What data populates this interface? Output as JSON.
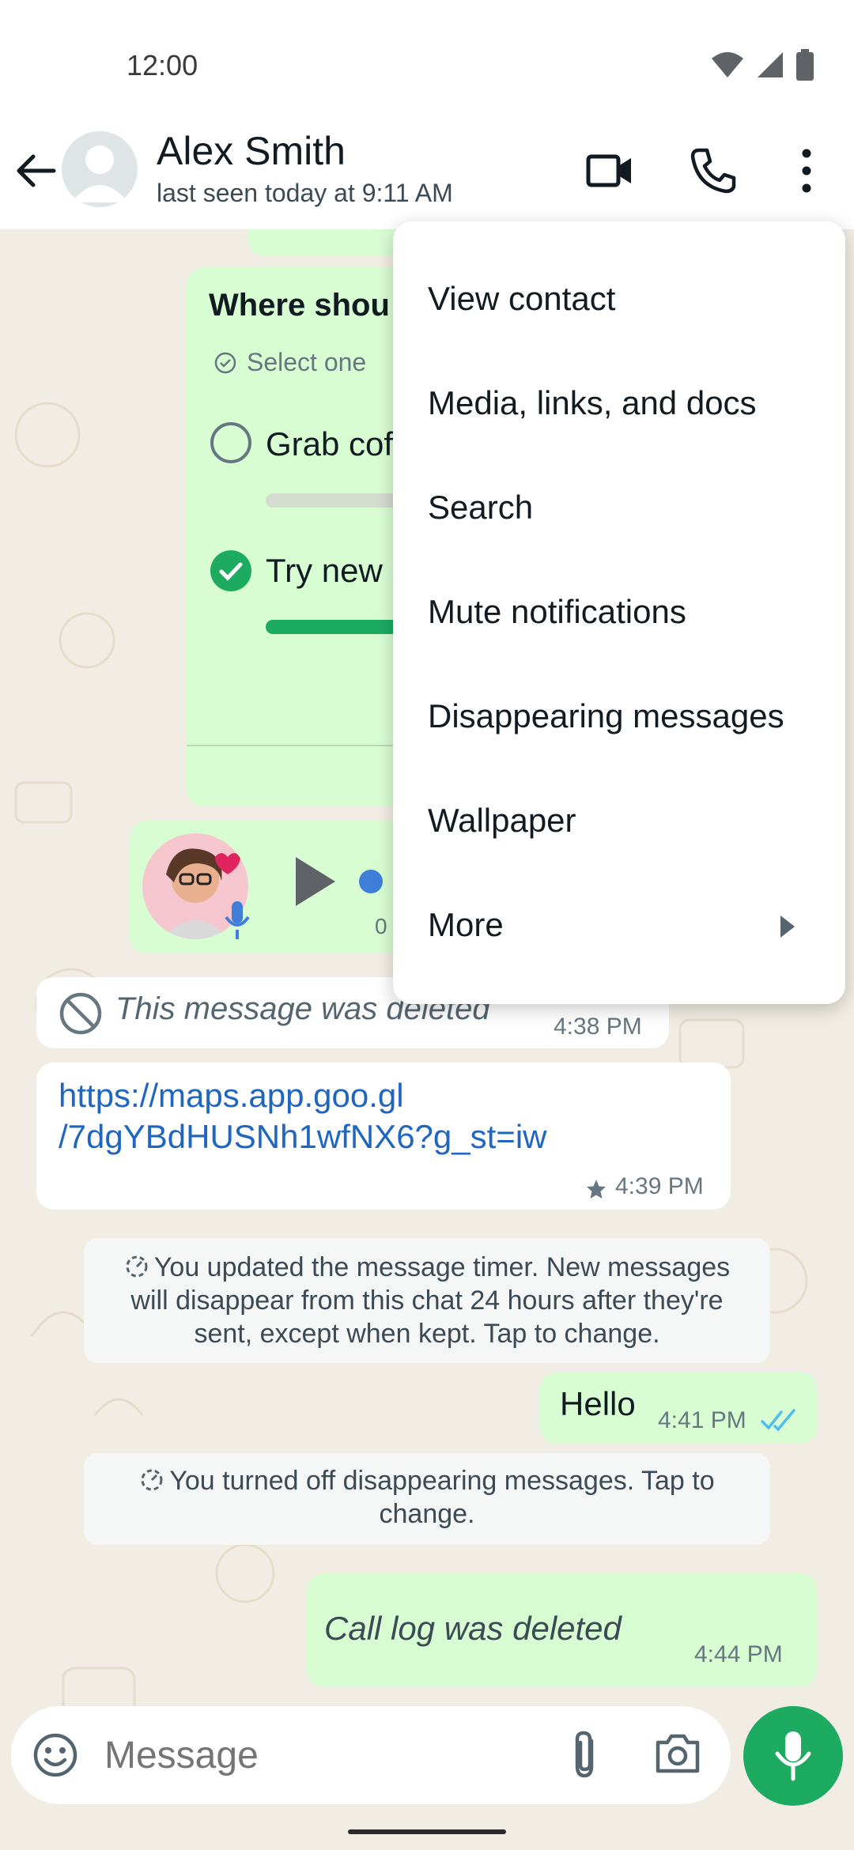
{
  "status": {
    "time": "12:00"
  },
  "header": {
    "name": "Alex Smith",
    "last_seen": "last seen today at 9:11 AM"
  },
  "poll": {
    "question": "Where shou",
    "hint": "Select one",
    "option1": "Grab cof",
    "option2": "Try new"
  },
  "voice": {
    "duration": "0"
  },
  "messages": {
    "deleted_text": "This message was deleted",
    "deleted_time": "4:38 PM",
    "link_line1": "https://maps.app.goo.gl",
    "link_line2": "/7dgYBdHUSNh1wfNX6?g_st=iw",
    "link_time": "4:39 PM",
    "timer_notice": "You updated the message timer. New messages will disappear from this chat 24 hours after they're sent, except when kept. Tap to change.",
    "hello_text": "Hello",
    "hello_time": "4:41 PM",
    "off_notice": "You turned off disappearing messages. Tap to change.",
    "calllog_text": "Call log was deleted",
    "calllog_time": "4:44 PM"
  },
  "menu": {
    "items": [
      "View contact",
      "Media, links, and docs",
      "Search",
      "Mute notifications",
      "Disappearing messages",
      "Wallpaper",
      "More"
    ]
  },
  "input": {
    "placeholder": "Message"
  },
  "colors": {
    "accent": "#1daa61",
    "outgoing": "#d9fdd3",
    "link": "#1f66c1",
    "read_ticks": "#53bdeb"
  }
}
